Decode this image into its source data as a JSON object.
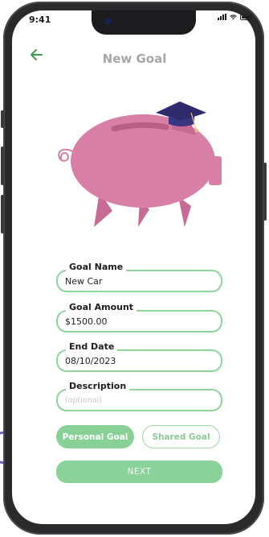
{
  "status_bar": {
    "time": "9:41"
  },
  "header": {
    "title": "New Goal",
    "back_icon": "arrow-left-icon"
  },
  "illustration": {
    "name": "piggy-bank-graduation-cap",
    "pig_color": "#d87fa5",
    "cap_color": "#2e2a6b"
  },
  "form": {
    "goal_name": {
      "label": "Goal Name",
      "value": "New Car"
    },
    "goal_amount": {
      "label": "Goal Amount",
      "value": "$1500.00"
    },
    "end_date": {
      "label": "End Date",
      "value": "08/10/2023"
    },
    "description": {
      "label": "Description",
      "placeholder": "(optional)"
    }
  },
  "goal_type": {
    "personal_label": "Personal Goal",
    "shared_label": "Shared Goal",
    "selected": "Personal Goal"
  },
  "next_button": {
    "label": "NEXT"
  },
  "colors": {
    "accent_green": "#88d196",
    "field_border": "#8fd49a",
    "title_gray": "#a6a6a6"
  }
}
